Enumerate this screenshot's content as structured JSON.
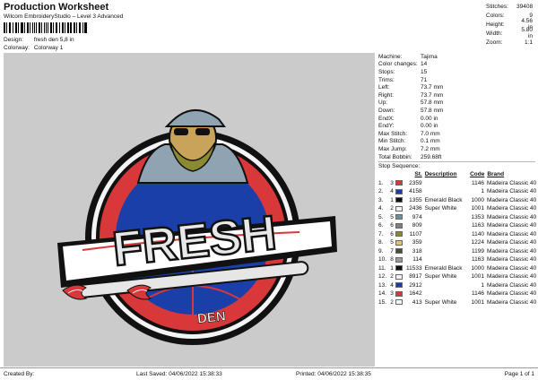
{
  "header": {
    "title": "Production Worksheet",
    "subtitle": "Wilcom EmbroideryStudio – Level 3 Advanced",
    "design_label": "Design:",
    "design_value": "fresh den 5,8 in",
    "colorway_label": "Colorway:",
    "colorway_value": "Colorway 1"
  },
  "stats": [
    {
      "label": "Stitches:",
      "value": "39408"
    },
    {
      "label": "Colors:",
      "value": "9"
    },
    {
      "label": "Height:",
      "value": "4.56 in"
    },
    {
      "label": "Width:",
      "value": "5.80 in"
    },
    {
      "label": "Zoom:",
      "value": "1:1"
    }
  ],
  "info": [
    {
      "label": "Machine:",
      "value": "Tajima"
    },
    {
      "label": "Color changes:",
      "value": "14"
    },
    {
      "label": "Stops:",
      "value": "15"
    },
    {
      "label": "Trims:",
      "value": "71"
    },
    {
      "label": "Left:",
      "value": "73.7 mm"
    },
    {
      "label": "Right:",
      "value": "73.7 mm"
    },
    {
      "label": "Up:",
      "value": "57.8 mm"
    },
    {
      "label": "Down:",
      "value": "57.8 mm"
    },
    {
      "label": "EndX:",
      "value": "0.00 in"
    },
    {
      "label": "EndY:",
      "value": "0.00 in"
    },
    {
      "label": "Max Stitch:",
      "value": "7.0 mm"
    },
    {
      "label": "Min Stitch:",
      "value": "0.1 mm"
    },
    {
      "label": "Max Jump:",
      "value": "7.2 mm"
    },
    {
      "label": "Total Bobbin:",
      "value": "259.68ft"
    }
  ],
  "sequence": {
    "title": "Stop Sequence:",
    "headers": {
      "st": "St.",
      "description": "Description",
      "code": "Code",
      "brand": "Brand"
    },
    "rows": [
      {
        "idx": "1.",
        "stop": "3",
        "color": "#d8383a",
        "st": "2359",
        "desc": "",
        "code": "1146",
        "brand": "Madeira Classic 40"
      },
      {
        "idx": "2.",
        "stop": "4",
        "color": "#1a3fa8",
        "st": "4158",
        "desc": "",
        "code": "1",
        "brand": "Madeira Classic 40"
      },
      {
        "idx": "3.",
        "stop": "1",
        "color": "#111111",
        "st": "1355",
        "desc": "Emerald Black",
        "code": "1000",
        "brand": "Madeira Classic 40"
      },
      {
        "idx": "4.",
        "stop": "2",
        "color": "#f4f4f4",
        "st": "2436",
        "desc": "Super White",
        "code": "1001",
        "brand": "Madeira Classic 40"
      },
      {
        "idx": "5.",
        "stop": "5",
        "color": "#6f8fa0",
        "st": "974",
        "desc": "",
        "code": "1353",
        "brand": "Madeira Classic 40"
      },
      {
        "idx": "6.",
        "stop": "6",
        "color": "#808080",
        "st": "809",
        "desc": "",
        "code": "1163",
        "brand": "Madeira Classic 40"
      },
      {
        "idx": "7.",
        "stop": "6",
        "color": "#8a8a30",
        "st": "1107",
        "desc": "",
        "code": "1140",
        "brand": "Madeira Classic 40"
      },
      {
        "idx": "8.",
        "stop": "5",
        "color": "#d9c47a",
        "st": "359",
        "desc": "",
        "code": "1224",
        "brand": "Madeira Classic 40"
      },
      {
        "idx": "9.",
        "stop": "7",
        "color": "#4a4a40",
        "st": "318",
        "desc": "",
        "code": "1199",
        "brand": "Madeira Classic 40"
      },
      {
        "idx": "10.",
        "stop": "8",
        "color": "#9a9a9a",
        "st": "114",
        "desc": "",
        "code": "1163",
        "brand": "Madeira Classic 40"
      },
      {
        "idx": "11.",
        "stop": "1",
        "color": "#111111",
        "st": "11533",
        "desc": "Emerald Black",
        "code": "1000",
        "brand": "Madeira Classic 40"
      },
      {
        "idx": "12.",
        "stop": "2",
        "color": "#f4f4f4",
        "st": "8917",
        "desc": "Super White",
        "code": "1001",
        "brand": "Madeira Classic 40"
      },
      {
        "idx": "13.",
        "stop": "4",
        "color": "#1a3fa8",
        "st": "2912",
        "desc": "",
        "code": "1",
        "brand": "Madeira Classic 40"
      },
      {
        "idx": "14.",
        "stop": "3",
        "color": "#d8383a",
        "st": "1642",
        "desc": "",
        "code": "1146",
        "brand": "Madeira Classic 40"
      },
      {
        "idx": "15.",
        "stop": "2",
        "color": "#f4f4f4",
        "st": "413",
        "desc": "Super White",
        "code": "1001",
        "brand": "Madeira Classic 40"
      }
    ]
  },
  "design": {
    "word_main": "FRESH",
    "word_sub": "DEN",
    "colors": {
      "red": "#d8383a",
      "blue": "#1a3fa8",
      "black": "#111111",
      "white": "#f4f4f4",
      "canvas": "#cbcbcb",
      "steel": "#8fa3b3"
    }
  },
  "footer": {
    "created": "Created By:",
    "saved": "Last Saved: 04/06/2022 15:38:33",
    "printed": "Printed: 04/06/2022 15:38:35",
    "page": "Page 1 of 1"
  }
}
